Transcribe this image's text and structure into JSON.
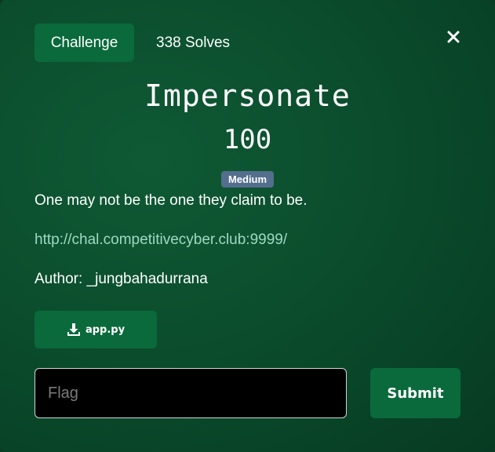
{
  "tabs": {
    "challenge_label": "Challenge",
    "solves_label": "338 Solves"
  },
  "challenge": {
    "name": "Impersonate",
    "points": "100",
    "difficulty": "Medium",
    "description": "One may not be the one they claim to be.",
    "link": "http://chal.competitivecyber.club:9999/",
    "author": "Author: _jungbahadurrana"
  },
  "files": [
    {
      "name": "app.py",
      "icon": "download-icon"
    }
  ],
  "flag_form": {
    "placeholder": "Flag",
    "value": "",
    "submit_label": "Submit"
  },
  "colors": {
    "modal_bg": "#0a4a2b",
    "button_green": "#0a6a3c",
    "badge": "#546e8d",
    "link": "#9ed9c0",
    "input_bg": "#000000"
  },
  "icons": {
    "close": "close-icon",
    "download": "download-icon"
  }
}
